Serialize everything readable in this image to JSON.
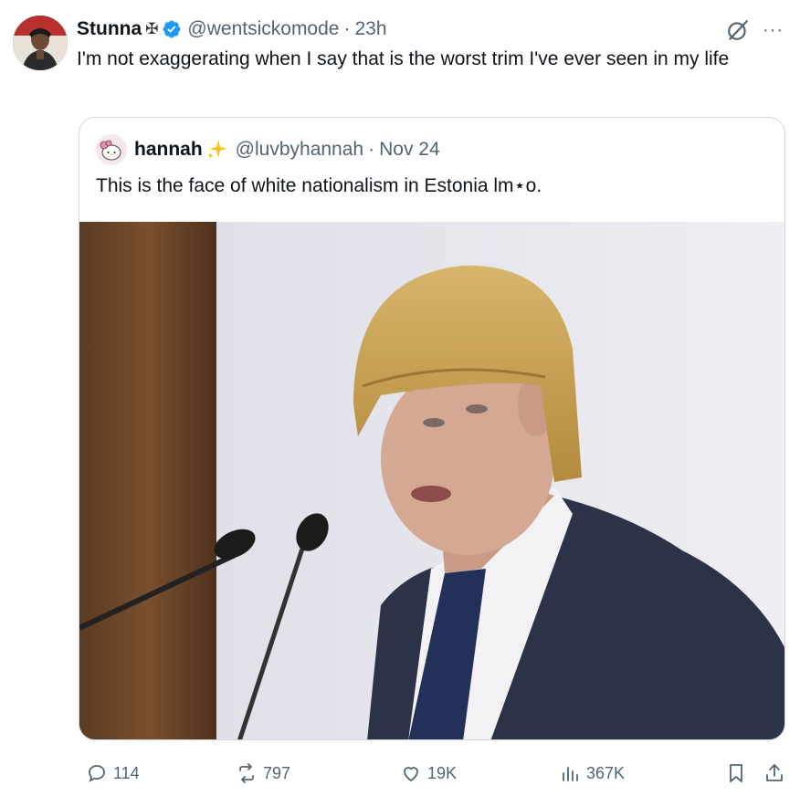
{
  "author": {
    "name": "Stunna",
    "name_emoji": "✠",
    "handle": "@wentsickomode",
    "separator": "·",
    "time": "23h"
  },
  "tweet": {
    "text": "I'm not exaggerating when I say that is the worst trim I've ever seen in my life"
  },
  "quoted": {
    "name": "hannah",
    "handle": "@luvbyhannah",
    "separator": "·",
    "date": "Nov 24",
    "text": "This is the face of white nationalism in Estonia lm⋆o."
  },
  "actions": {
    "replies": "114",
    "reposts": "797",
    "likes": "19K",
    "views": "367K"
  },
  "icons": {
    "verified": "verified-badge-icon",
    "grok": "grok-icon",
    "more": "more-icon",
    "reply": "reply-icon",
    "repost": "repost-icon",
    "like": "like-icon",
    "views": "views-icon",
    "bookmark": "bookmark-icon",
    "share": "share-icon"
  },
  "colors": {
    "text": "#0f1419",
    "secondary": "#536471",
    "border": "#cfd9de",
    "verified": "#1d9bf0",
    "sparkle": "#f5c518"
  }
}
